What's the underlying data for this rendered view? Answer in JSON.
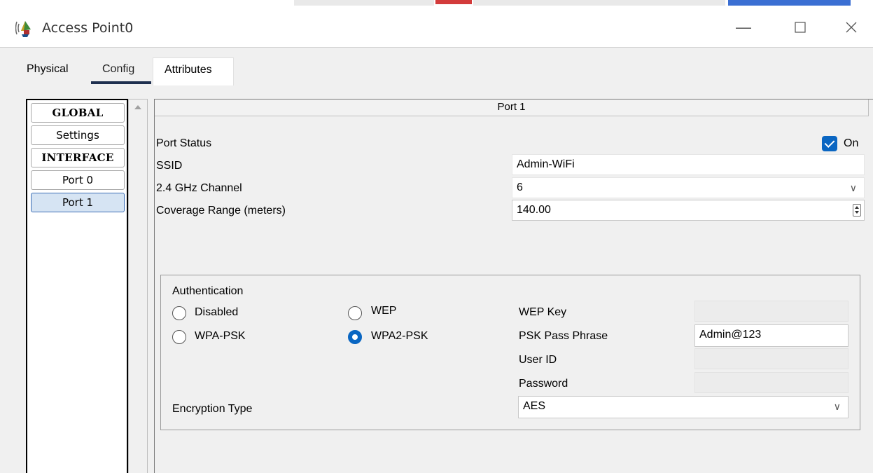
{
  "window": {
    "title": "Access Point0"
  },
  "tabs": {
    "physical": "Physical",
    "config": "Config",
    "attributes": "Attributes"
  },
  "sidebar": {
    "items": [
      {
        "label": "GLOBAL"
      },
      {
        "label": "Settings"
      },
      {
        "label": "INTERFACE"
      },
      {
        "label": "Port 0"
      },
      {
        "label": "Port 1"
      }
    ]
  },
  "port": {
    "header": "Port 1",
    "status_label": "Port Status",
    "status_on_label": "On",
    "ssid_label": "SSID",
    "ssid_value": "Admin-WiFi",
    "channel_label": "2.4 GHz Channel",
    "channel_value": "6",
    "coverage_label": "Coverage Range (meters)",
    "coverage_value": "140.00"
  },
  "auth": {
    "title": "Authentication",
    "disabled": "Disabled",
    "wep": "WEP",
    "wpa_psk": "WPA-PSK",
    "wpa2_psk": "WPA2-PSK",
    "wep_key_label": "WEP Key",
    "psk_label": "PSK Pass Phrase",
    "psk_value": "Admin@123",
    "user_id_label": "User ID",
    "password_label": "Password",
    "encryption_label": "Encryption Type",
    "encryption_value": "AES"
  },
  "colors": {
    "accent": "#0a66c2",
    "selected_bg": "#d6e4f3",
    "tab_underline": "#1e2f4f"
  }
}
